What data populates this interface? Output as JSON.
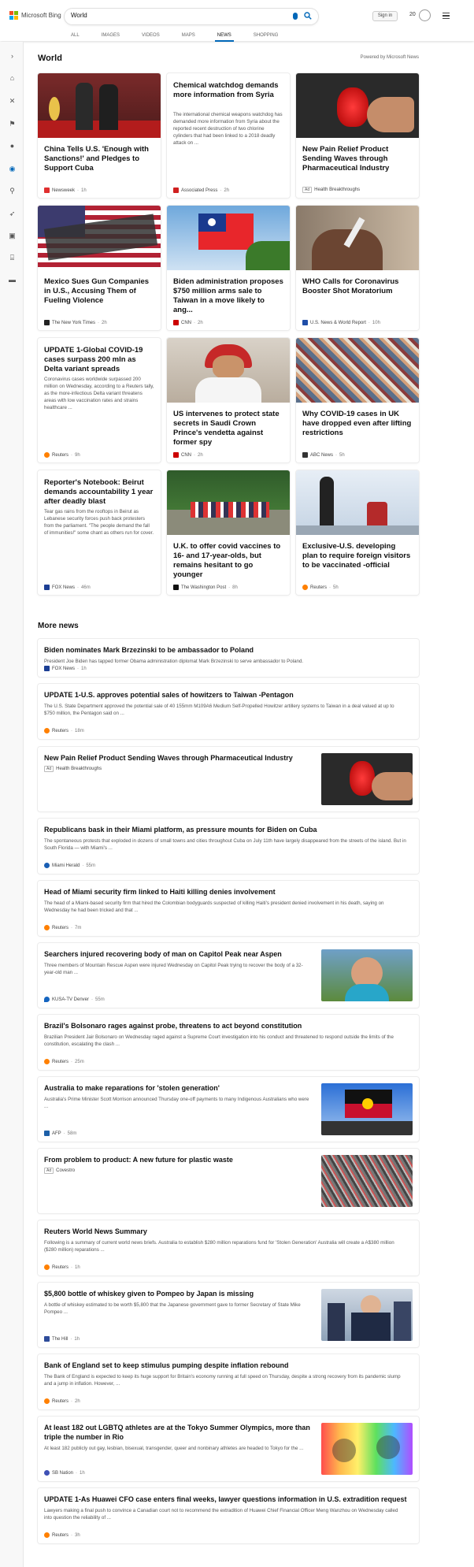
{
  "brand": {
    "name": "Microsoft Bing",
    "colors": [
      "#f25022",
      "#7fba00",
      "#00a4ef",
      "#ffb900"
    ]
  },
  "search": {
    "value": "World"
  },
  "account": {
    "sign_in": "Sign in",
    "points": "20"
  },
  "scopes": [
    "ALL",
    "IMAGES",
    "VIDEOS",
    "MAPS",
    "NEWS",
    "SHOPPING"
  ],
  "active_scope": "NEWS",
  "rail_icons": [
    "chevron-right-icon",
    "home-icon",
    "science-icon",
    "flag-icon",
    "location-icon",
    "globe-icon",
    "microscope-icon",
    "rocket-icon",
    "film-icon",
    "bank-icon",
    "card-icon"
  ],
  "section": {
    "title": "World",
    "powered_by": "Powered by Microsoft News"
  },
  "cards": [
    {
      "title": "China Tells U.S. 'Enough with Sanctions!' and Pledges to Support Cuba",
      "source": "Newsweek",
      "age": "1h",
      "fav": "#e03030"
    },
    {
      "title": "Chemical watchdog demands more information from Syria",
      "snippet": "The international chemical weapons watchdog has demanded more information from Syria about the reported recent destruction of two chlorine cylinders that had been linked to a 2018 deadly attack on ...",
      "source": "Associated Press",
      "age": "2h",
      "fav": "#d02020"
    },
    {
      "title": "New Pain Relief Product Sending Waves through Pharmaceutical Industry",
      "ad": "Ad",
      "source": "Health Breakthroughs",
      "age": ""
    },
    {
      "title": "Mexico Sues Gun Companies in U.S., Accusing Them of Fueling Violence",
      "source": "The New York Times",
      "age": "2h",
      "fav": "#222222"
    },
    {
      "title": "Biden administration proposes $750 million arms sale to Taiwan in a move likely to ang...",
      "source": "CNN",
      "age": "2h",
      "fav": "#cc0000"
    },
    {
      "title": "WHO Calls for Coronavirus Booster Shot Moratorium",
      "source": "U.S. News & World Report",
      "age": "10h",
      "fav": "#1f4ea8"
    },
    {
      "title": "UPDATE 1-Global COVID-19 cases surpass 200 mln as Delta variant spreads",
      "snippet": "Coronavirus cases worldwide surpassed 200 million on Wednesday, according to a Reuters tally, as the more-infectious Delta variant threatens areas with low vaccination rates and strains healthcare ...",
      "source": "Reuters",
      "age": "9h",
      "fav": "#ff8000"
    },
    {
      "title": "US intervenes to protect state secrets in Saudi Crown Prince's vendetta against former spy",
      "source": "CNN",
      "age": "2h",
      "fav": "#cc0000"
    },
    {
      "title": "Why COVID-19 cases in UK have dropped even after lifting restrictions",
      "source": "ABC News",
      "age": "5h",
      "fav": "#333333"
    },
    {
      "title": "Reporter's Notebook: Beirut demands accountability 1 year after deadly blast",
      "snippet": "Tear gas rains from the rooftops in Beirut as Lebanese security forces push back protesters from the parliament. \"The people demand the fall of immunities!\" some chant as others run for cover.",
      "source": "FOX News",
      "age": "46m",
      "fav": "#1c3f94"
    },
    {
      "title": "U.K. to offer covid vaccines to 16- and 17-year-olds, but remains hesitant to go younger",
      "source": "The Washington Post",
      "age": "8h",
      "fav": "#111111"
    },
    {
      "title": "Exclusive-U.S. developing plan to require foreign visitors to be vaccinated -official",
      "source": "Reuters",
      "age": "5h",
      "fav": "#ff8000"
    }
  ],
  "more_news": {
    "title": "More news",
    "items": [
      {
        "title": "Biden nominates Mark Brzezinski to be ambassador to Poland",
        "snippet": "President Joe Biden has tapped former Obama administration diplomat Mark Brzezinski to serve ambassador to Poland.",
        "source": "FOX News",
        "age": "1h",
        "fav": "#1c3f94"
      },
      {
        "title": "UPDATE 1-U.S. approves potential sales of howitzers to Taiwan -Pentagon",
        "snippet": "The U.S. State Department approved the potential sale of 40 155mm M109A6 Medium Self-Propelled Howitzer artillery systems to Taiwan in a deal valued at up to $750 million, the Pentagon said on ...",
        "source": "Reuters",
        "age": "18m",
        "fav": "#ff8000"
      },
      {
        "title": "New Pain Relief Product Sending Waves through Pharmaceutical Industry",
        "ad": "Ad",
        "source": "Health Breakthroughs",
        "age": ""
      },
      {
        "title": "Republicans bask in their Miami platform, as pressure mounts for Biden on Cuba",
        "snippet": "The spontaneous protests that exploded in dozens of small towns and cities throughout Cuba on July 11th have largely disappeared from the streets of the island. But in South Florida — with Miami's ...",
        "source": "Miami Herald",
        "age": "55m",
        "fav": "#1a5fb4"
      },
      {
        "title": "Head of Miami security firm linked to Haiti killing denies involvement",
        "snippet": "The head of a Miami-based security firm that hired the Colombian bodyguards suspected of killing Haiti's president denied involvement in his death, saying on Wednesday he had been tricked and that ...",
        "source": "Reuters",
        "age": "7m",
        "fav": "#ff8000"
      },
      {
        "title": "Searchers injured recovering body of man on Capitol Peak near Aspen",
        "snippet": "Three members of Mountain Rescue Aspen were injured Wednesday on Capitol Peak trying to recover the body of a 32-year-old man ...",
        "source": "KUSA-TV Denver",
        "age": "55m",
        "fav": "#1565c0"
      },
      {
        "title": "Brazil's Bolsonaro rages against probe, threatens to act beyond constitution",
        "snippet": "Brazilian President Jair Bolsonaro on Wednesday raged against a Supreme Court investigation into his conduct and threatened to respond outside the limits of the constitution, escalating the clash ...",
        "source": "Reuters",
        "age": "25m",
        "fav": "#ff8000"
      },
      {
        "title": "Australia to make reparations for 'stolen generation'",
        "snippet": "Australia's Prime Minister Scott Morrison announced Thursday one-off payments to many Indigenous Australians who were ...",
        "source": "AFP",
        "age": "58m",
        "fav": "#1d5fa8"
      },
      {
        "title": "From problem to product: A new future for plastic waste",
        "ad": "Ad",
        "source": "Covestro",
        "age": ""
      },
      {
        "title": "Reuters World News Summary",
        "snippet": "Following is a summary of current world news briefs. Australia to establish $280 million reparations fund for 'Stolen Generation' Australia will create a A$380 million ($280 million) reparations ...",
        "source": "Reuters",
        "age": "1h",
        "fav": "#ff8000"
      },
      {
        "title": "$5,800 bottle of whiskey given to Pompeo by Japan is missing",
        "snippet": "A bottle of whiskey estimated to be worth $5,800 that the Japanese government gave to former Secretary of State Mike Pompeo ...",
        "source": "The Hill",
        "age": "1h",
        "fav": "#2e4c9a"
      },
      {
        "title": "Bank of England set to keep stimulus pumping despite inflation rebound",
        "snippet": "The Bank of England is expected to keep its huge support for Britain's economy running at full speed on Thursday, despite a strong recovery from its pandemic slump and a jump in inflation. However, ...",
        "source": "Reuters",
        "age": "2h",
        "fav": "#ff8000"
      },
      {
        "title": "At least 182 out LGBTQ athletes are at the Tokyo Summer Olympics, more than triple the number in Rio",
        "snippet": "At least 182 publicly out gay, lesbian, bisexual, transgender, queer and nonbinary athletes are headed to Tokyo for the ...",
        "source": "SB Nation",
        "age": "1h",
        "fav": "#3f51b5"
      },
      {
        "title": "UPDATE 1-As Huawei CFO case enters final weeks, lawyer questions information in U.S. extradition request",
        "snippet": "Lawyers making a final push to convince a Canadian court not to recommend the extradition of Huawei Chief Financial Officer Meng Wanzhou on Wednesday called into question the reliability of ...",
        "source": "Reuters",
        "age": "3h",
        "fav": "#ff8000"
      }
    ]
  }
}
